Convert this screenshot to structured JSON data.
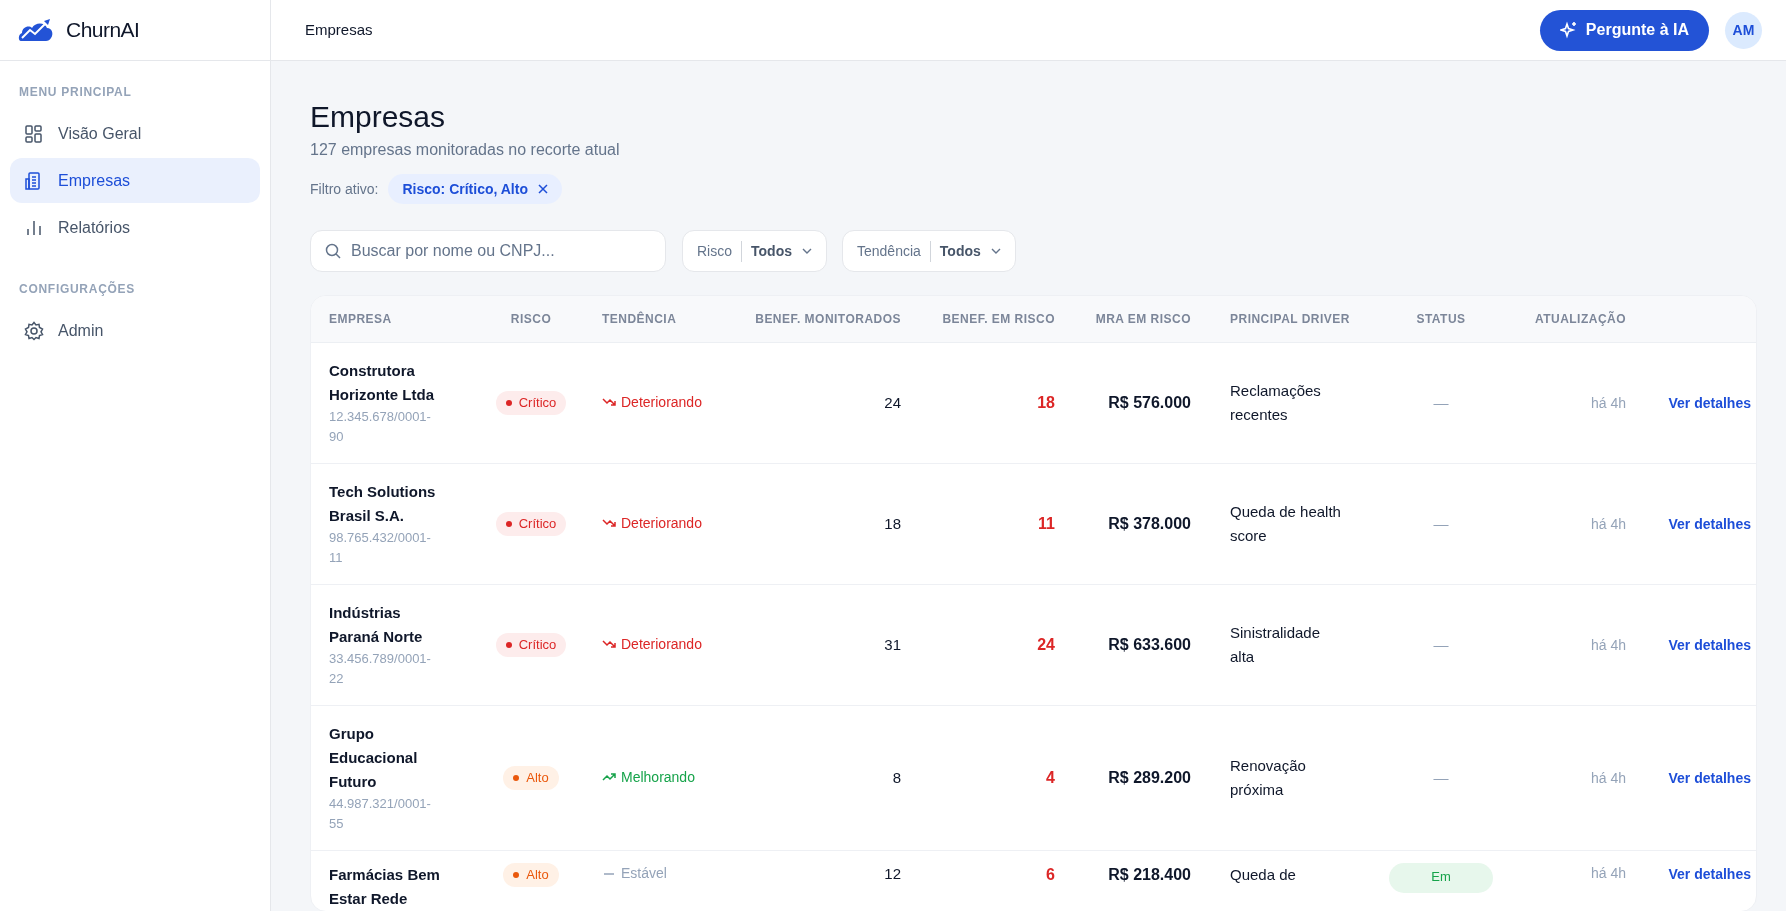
{
  "brand": {
    "name": "ChurnAI"
  },
  "sidebar": {
    "sections": [
      {
        "title": "MENU PRINCIPAL",
        "items": [
          {
            "label": "Visão Geral",
            "kind": "grid",
            "selected": false
          },
          {
            "label": "Empresas",
            "kind": "building",
            "selected": true
          },
          {
            "label": "Relatórios",
            "kind": "bars",
            "selected": false
          }
        ]
      },
      {
        "title": "CONFIGURAÇÕES",
        "items": [
          {
            "label": "Admin",
            "kind": "gear",
            "selected": false
          }
        ]
      }
    ]
  },
  "topbar": {
    "title": "Empresas",
    "ask_button": "Pergunte à IA",
    "avatar": "AM"
  },
  "page": {
    "title": "Empresas",
    "subtitle": "127 empresas monitoradas no recorte atual",
    "filter_label": "Filtro ativo:",
    "filter_chip": "Risco: Crítico, Alto"
  },
  "search": {
    "placeholder": "Buscar por nome ou CNPJ..."
  },
  "dropdowns": [
    {
      "label": "Risco",
      "value": "Todos"
    },
    {
      "label": "Tendência",
      "value": "Todos"
    }
  ],
  "table": {
    "columns": [
      "EMPRESA",
      "RISCO",
      "TENDÊNCIA",
      "BENEF. MONITORADOS",
      "BENEF. EM RISCO",
      "MRA EM RISCO",
      "PRINCIPAL DRIVER",
      "STATUS",
      "ATUALIZAÇÃO"
    ],
    "rows": [
      {
        "company": "Construtora Horizonte Ltda",
        "cnpj": "12.345.678/0001-90",
        "risk": {
          "label": "Crítico",
          "kind": "critical"
        },
        "trend": {
          "label": "Deteriorando",
          "kind": "down"
        },
        "monitored": "24",
        "at_risk": "18",
        "mra": "R$ 576.000",
        "driver": "Reclamações recentes",
        "status": {
          "kind": "none",
          "label": "—"
        },
        "updated": "há 4h",
        "action": "Ver detalhes"
      },
      {
        "company": "Tech Solutions Brasil S.A.",
        "cnpj": "98.765.432/0001-11",
        "risk": {
          "label": "Crítico",
          "kind": "critical"
        },
        "trend": {
          "label": "Deteriorando",
          "kind": "down"
        },
        "monitored": "18",
        "at_risk": "11",
        "mra": "R$ 378.000",
        "driver": "Queda de health score",
        "status": {
          "kind": "none",
          "label": "—"
        },
        "updated": "há 4h",
        "action": "Ver detalhes"
      },
      {
        "company": "Indústrias Paraná Norte",
        "cnpj": "33.456.789/0001-22",
        "risk": {
          "label": "Crítico",
          "kind": "critical"
        },
        "trend": {
          "label": "Deteriorando",
          "kind": "down"
        },
        "monitored": "31",
        "at_risk": "24",
        "mra": "R$ 633.600",
        "driver": "Sinistralidade alta",
        "status": {
          "kind": "none",
          "label": "—"
        },
        "updated": "há 4h",
        "action": "Ver detalhes"
      },
      {
        "company": "Grupo Educacional Futuro",
        "cnpj": "44.987.321/0001-55",
        "risk": {
          "label": "Alto",
          "kind": "high"
        },
        "trend": {
          "label": "Melhorando",
          "kind": "up"
        },
        "monitored": "8",
        "at_risk": "4",
        "mra": "R$ 289.200",
        "driver": "Renovação próxima",
        "status": {
          "kind": "none",
          "label": "—"
        },
        "updated": "há 4h",
        "action": "Ver detalhes"
      },
      {
        "company": "Farmácias Bem Estar Rede",
        "risk": {
          "label": "Alto",
          "kind": "high"
        },
        "trend": {
          "label": "Estável",
          "kind": "flat"
        },
        "monitored": "12",
        "at_risk": "6",
        "mra": "R$ 218.400",
        "driver": "Queda de",
        "status": {
          "kind": "badge",
          "label": "Em"
        },
        "updated": "há 4h",
        "action": "Ver detalhes"
      }
    ]
  }
}
